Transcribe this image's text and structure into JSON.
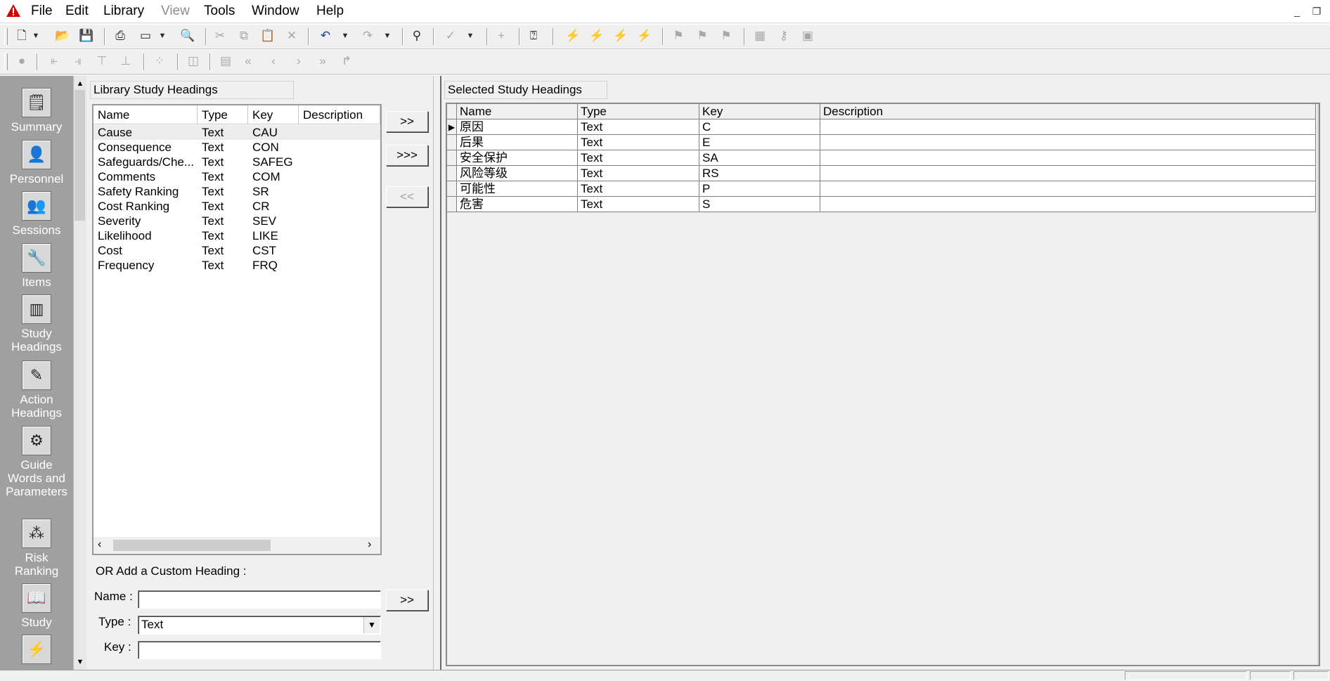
{
  "menu": {
    "items": [
      {
        "label": "File"
      },
      {
        "label": "Edit"
      },
      {
        "label": "Library"
      },
      {
        "label": "View"
      },
      {
        "label": "Tools"
      },
      {
        "label": "Window"
      },
      {
        "label": "Help"
      }
    ]
  },
  "window_controls": {
    "minimize": "_",
    "restore": "❐"
  },
  "nav": {
    "items": [
      {
        "label": "Summary"
      },
      {
        "label": "Personnel"
      },
      {
        "label": "Sessions"
      },
      {
        "label": "Items"
      },
      {
        "label_lines": [
          "Study",
          "Headings"
        ]
      },
      {
        "label_lines": [
          "Action",
          "Headings"
        ]
      },
      {
        "label_lines": [
          "Guide",
          "Words and",
          "Parameters"
        ]
      },
      {
        "label_lines": [
          "Risk",
          "Ranking"
        ]
      },
      {
        "label": "Study"
      },
      {
        "label": ""
      }
    ]
  },
  "library_panel": {
    "title": "Library Study Headings",
    "columns": [
      "Name",
      "Type",
      "Key",
      "Description"
    ],
    "rows": [
      {
        "name": "Cause",
        "type": "Text",
        "key": "CAU",
        "description": ""
      },
      {
        "name": "Consequence",
        "type": "Text",
        "key": "CON",
        "description": ""
      },
      {
        "name": "Safeguards/Che...",
        "type": "Text",
        "key": "SAFEG",
        "description": ""
      },
      {
        "name": "Comments",
        "type": "Text",
        "key": "COM",
        "description": ""
      },
      {
        "name": "Safety Ranking",
        "type": "Text",
        "key": "SR",
        "description": ""
      },
      {
        "name": "Cost Ranking",
        "type": "Text",
        "key": "CR",
        "description": ""
      },
      {
        "name": "Severity",
        "type": "Text",
        "key": "SEV",
        "description": ""
      },
      {
        "name": "Likelihood",
        "type": "Text",
        "key": "LIKE",
        "description": ""
      },
      {
        "name": "Cost",
        "type": "Text",
        "key": "CST",
        "description": ""
      },
      {
        "name": "Frequency",
        "type": "Text",
        "key": "FRQ",
        "description": ""
      }
    ]
  },
  "transfer_buttons": {
    "add": ">>",
    "add_all": ">>>",
    "remove": "<<"
  },
  "custom_heading": {
    "title": "OR Add a Custom Heading :",
    "name_label": "Name :",
    "name_value": "",
    "type_label": "Type :",
    "type_value": "Text",
    "key_label": "Key :",
    "key_value": "",
    "add_button": ">>"
  },
  "selected_panel": {
    "title": "Selected Study Headings",
    "columns": [
      "Name",
      "Type",
      "Key",
      "Description"
    ],
    "rows": [
      {
        "name": "原因",
        "type": "Text",
        "key": "C",
        "description": ""
      },
      {
        "name": "后果",
        "type": "Text",
        "key": "E",
        "description": ""
      },
      {
        "name": "安全保护",
        "type": "Text",
        "key": "SA",
        "description": ""
      },
      {
        "name": "风险等级",
        "type": "Text",
        "key": "RS",
        "description": ""
      },
      {
        "name": "可能性",
        "type": "Text",
        "key": "P",
        "description": ""
      },
      {
        "name": "危害",
        "type": "Text",
        "key": "S",
        "description": ""
      }
    ]
  },
  "icons": {
    "app": "warning-triangle-icon",
    "nav": [
      "summary-icon",
      "personnel-icon",
      "sessions-icon",
      "items-icon",
      "study-headings-icon",
      "action-headings-icon",
      "guide-words-icon",
      "risk-ranking-icon",
      "study-icon",
      "action-icon"
    ]
  },
  "colors": {
    "app_icon": "#d40000",
    "nav_bg": "#a0a0a0",
    "window_bg": "#f0f0f0"
  }
}
